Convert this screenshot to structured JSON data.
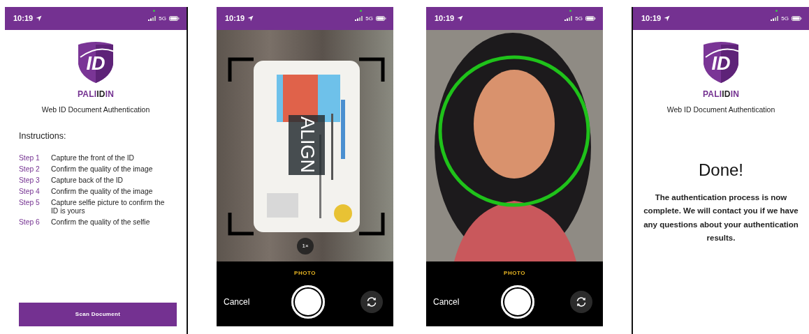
{
  "screens": [
    {
      "kind": "instructions",
      "status_bar": {
        "time": "10:19",
        "network": "5G"
      },
      "logo_text": "ID",
      "brand": {
        "prefix": "PALI",
        "highlight": "ID",
        "suffix": "IN"
      },
      "subtitle": "Web ID Document Authentication",
      "heading": "Instructions:",
      "steps": [
        {
          "label": "Step 1",
          "text": "Capture the front of the ID"
        },
        {
          "label": "Step 2",
          "text": "Confirm the quality of the image"
        },
        {
          "label": "Step 3",
          "text": "Capture back of the ID"
        },
        {
          "label": "Step 4",
          "text": "Confirm the quality of the image"
        },
        {
          "label": "Step 5",
          "text": "Capture selfie picture to confirm the ID is yours"
        },
        {
          "label": "Step 6",
          "text": "Confirm the quality of the selfie"
        }
      ],
      "button": "Scan Document"
    },
    {
      "kind": "document_camera",
      "status_bar": {
        "time": "10:19",
        "network": "5G"
      },
      "align_label": "ALIGN",
      "zoom": "1×",
      "mode": "PHOTO",
      "cancel": "Cancel"
    },
    {
      "kind": "face_camera",
      "status_bar": {
        "time": "10:19",
        "network": "5G"
      },
      "mode": "PHOTO",
      "cancel": "Cancel"
    },
    {
      "kind": "done",
      "status_bar": {
        "time": "10:19",
        "network": "5G"
      },
      "logo_text": "ID",
      "brand": {
        "prefix": "PALI",
        "highlight": "ID",
        "suffix": "IN"
      },
      "subtitle": "Web ID Document Authentication",
      "title": "Done!",
      "message": "The authentication process is now complete. We will contact you if we have any questions about your authentication results."
    }
  ]
}
